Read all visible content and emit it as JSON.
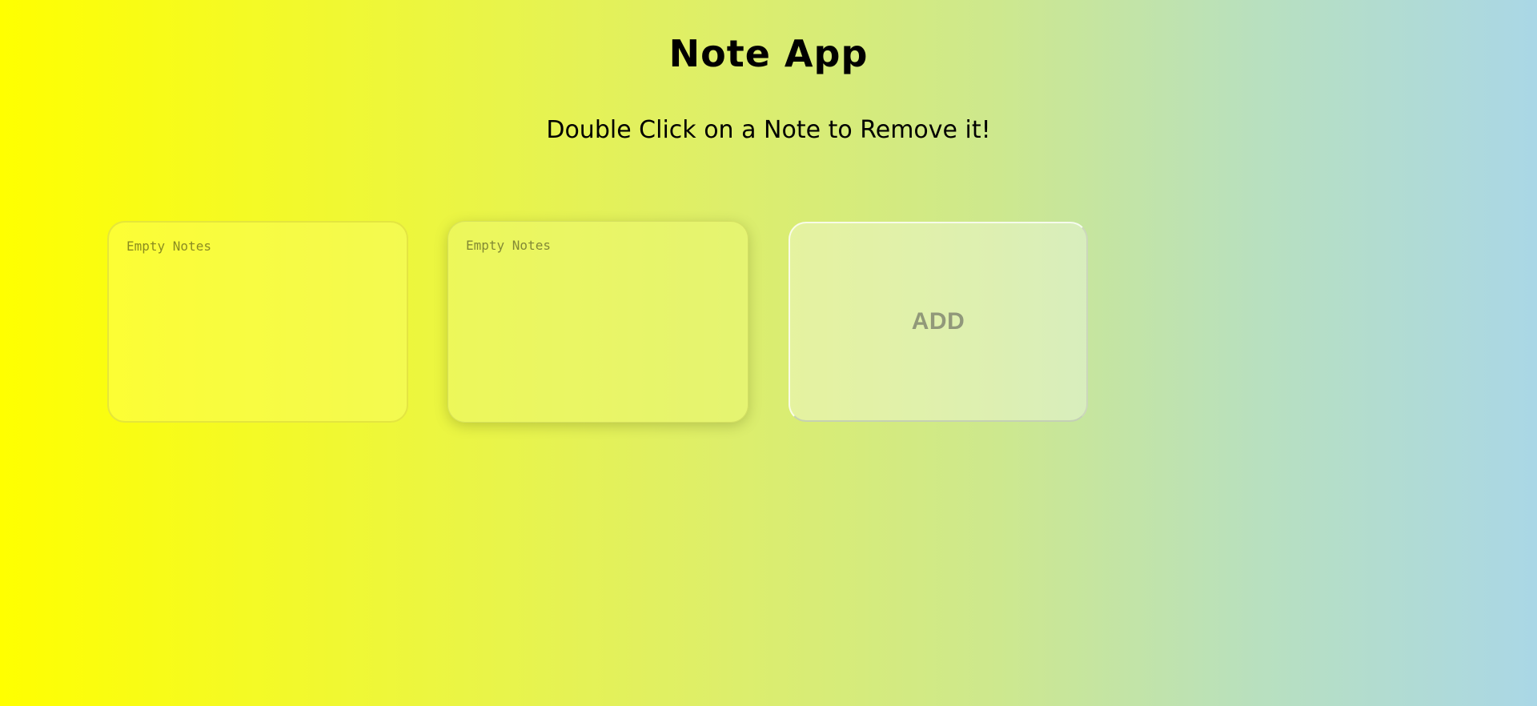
{
  "header": {
    "title": "Note App",
    "subtitle": "Double Click on a Note to Remove it!"
  },
  "notes": [
    {
      "placeholder": "Empty Notes",
      "value": ""
    },
    {
      "placeholder": "Empty Notes",
      "value": ""
    }
  ],
  "add_button": {
    "label": "ADD"
  },
  "colors": {
    "gradient_start": "#ffff00",
    "gradient_end": "#aad7e6"
  }
}
